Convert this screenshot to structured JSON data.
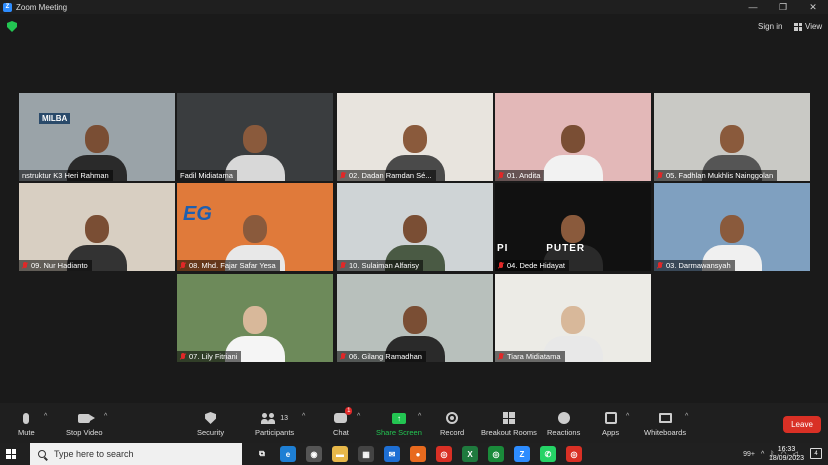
{
  "window": {
    "title": "Zoom Meeting",
    "minimize": "—",
    "maximize": "❐",
    "close": "✕"
  },
  "topbar": {
    "sign_in": "Sign in",
    "view": "View"
  },
  "participants": [
    {
      "name": "nstruktur K3 Heri Rahman",
      "muted": false,
      "bg": "#9aa3a8",
      "body": "#2a2a2a",
      "skin": "#7a4e34",
      "active": false
    },
    {
      "name": "Fadil Midiatama",
      "muted": false,
      "bg": "#3a3d3f",
      "body": "#d8d8d8",
      "skin": "#8a5a3c",
      "active": true
    },
    {
      "name": "02. Dadan Ramdan Sé...",
      "muted": true,
      "bg": "#e8e4de",
      "body": "#4a4a4a",
      "skin": "#8a5a3c",
      "active": false
    },
    {
      "name": "01. Andita",
      "muted": true,
      "bg": "#e3b8b8",
      "body": "#f2f2f2",
      "skin": "#7a4e34",
      "active": false
    },
    {
      "name": "05. Fadhlan Mukhlis Nainggolan",
      "muted": true,
      "bg": "#c9c9c5",
      "body": "#555",
      "skin": "#8a5a3c",
      "active": false
    },
    {
      "name": "09. Nur Hadianto",
      "muted": true,
      "bg": "#d8cfc2",
      "body": "#333",
      "skin": "#7a4e34",
      "active": false
    },
    {
      "name": "08. Mhd. Fajar Safar Yesa",
      "muted": true,
      "bg": "#e07a3a",
      "body": "#e8e8e8",
      "skin": "#8a5a3c",
      "active": false
    },
    {
      "name": "10. Sulaiman Alfarisy",
      "muted": true,
      "bg": "#cfd4d6",
      "body": "#4a5a44",
      "skin": "#7a4e34",
      "active": false
    },
    {
      "name": "04. Dede Hidayat",
      "muted": true,
      "bg": "#111111",
      "body": "#2a2a2a",
      "skin": "#8a5a3c",
      "active": false
    },
    {
      "name": "03. Darmawansyah",
      "muted": true,
      "bg": "#7fa0c0",
      "body": "#f0f0f0",
      "skin": "#8a5a3c",
      "active": false
    },
    {
      "name": "07. Lily Fitriani",
      "muted": true,
      "bg": "#6d8a5a",
      "body": "#f5f5f5",
      "skin": "#d8b89a",
      "active": false
    },
    {
      "name": "06. Gilang Ramadhan",
      "muted": true,
      "bg": "#b8c0bc",
      "body": "#2a2a2a",
      "skin": "#7a4e34",
      "active": false
    },
    {
      "name": "Tiara Midiatama",
      "muted": true,
      "bg": "#ecebe6",
      "body": "#e8e8e8",
      "skin": "#d8b89a",
      "active": false
    }
  ],
  "tile_overlays": {
    "t0_logo": "MILBA",
    "t6_logo": "EG",
    "t8_text": "PI          PUTER"
  },
  "toolbar": {
    "mute": "Mute",
    "stop_video": "Stop Video",
    "security": "Security",
    "participants": "Participants",
    "participants_count": "13",
    "chat": "Chat",
    "chat_badge": "1",
    "share_screen": "Share Screen",
    "record": "Record",
    "breakout_rooms": "Breakout Rooms",
    "reactions": "Reactions",
    "apps": "Apps",
    "whiteboards": "Whiteboards",
    "leave": "Leave"
  },
  "taskbar": {
    "search_placeholder": "Type here to search",
    "time": "16:33",
    "date": "18/09/2023",
    "notification_count": "4",
    "tray_badge": "99+",
    "apps": [
      {
        "name": "task-view",
        "color": "#202020",
        "glyph": "⧉"
      },
      {
        "name": "edge",
        "color": "#1e7fd4",
        "glyph": "e"
      },
      {
        "name": "camera",
        "color": "#555",
        "glyph": "◉"
      },
      {
        "name": "file-explorer",
        "color": "#e8b84a",
        "glyph": "▬"
      },
      {
        "name": "store",
        "color": "#444",
        "glyph": "▦"
      },
      {
        "name": "mail",
        "color": "#1e6fd4",
        "glyph": "✉"
      },
      {
        "name": "firefox",
        "color": "#e86a1e",
        "glyph": "●"
      },
      {
        "name": "chrome-1",
        "color": "#d93025",
        "glyph": "◎"
      },
      {
        "name": "excel",
        "color": "#1f7a3e",
        "glyph": "X"
      },
      {
        "name": "chrome-2",
        "color": "#1a8a3a",
        "glyph": "◎"
      },
      {
        "name": "zoom",
        "color": "#2d8cff",
        "glyph": "Z"
      },
      {
        "name": "whatsapp",
        "color": "#25d366",
        "glyph": "✆"
      },
      {
        "name": "chrome-3",
        "color": "#d93025",
        "glyph": "◎"
      }
    ]
  }
}
